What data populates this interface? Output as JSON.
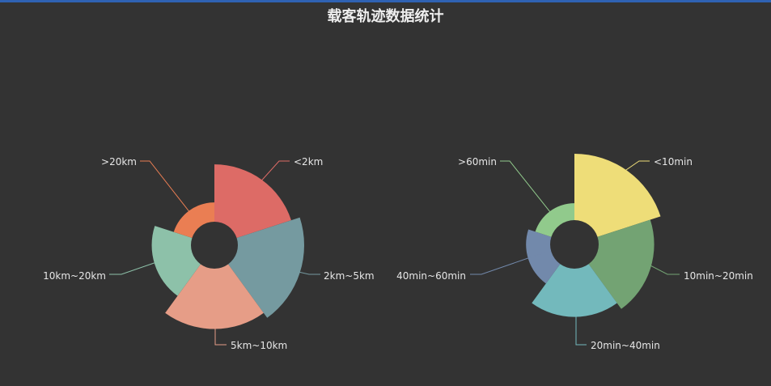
{
  "page": {
    "title": "载客轨迹数据统计"
  },
  "chart_data": [
    {
      "type": "pie",
      "variant": "rose",
      "categories": [
        "<2km",
        "2km~5km",
        "5km~10km",
        "10km~20km",
        ">20km"
      ],
      "values": [
        95,
        110,
        100,
        65,
        32
      ],
      "colors": [
        "#dd6b66",
        "#759aa0",
        "#e69d87",
        "#8dc1a9",
        "#ea7e53"
      ]
    },
    {
      "type": "pie",
      "variant": "rose",
      "categories": [
        "<10min",
        "10min~20min",
        "20min~40min",
        "40min~60min",
        ">60min"
      ],
      "values": [
        110,
        92,
        80,
        40,
        28
      ],
      "colors": [
        "#eedd78",
        "#73a373",
        "#73b9bc",
        "#7289ab",
        "#91ca8c"
      ]
    }
  ]
}
